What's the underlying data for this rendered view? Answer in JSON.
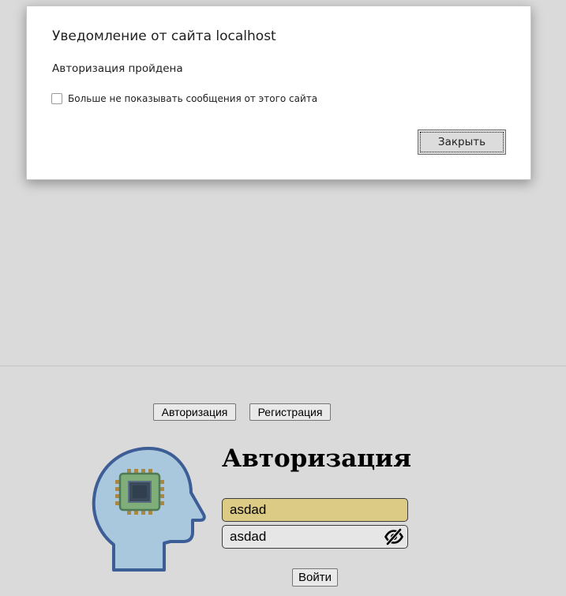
{
  "dialog": {
    "title": "Уведомление от сайта localhost",
    "message": "Авторизация пройдена",
    "suppress_checkbox": {
      "label": "Больше не показывать сообщения от этого сайта",
      "checked": false
    },
    "close_label": "Закрыть"
  },
  "nav": {
    "login_label": "Авторизация",
    "register_label": "Регистрация"
  },
  "form": {
    "title": "Авторизация",
    "login_value": "asdad",
    "password_value": "asdad",
    "submit_label": "Войти",
    "password_toggle_icon": "eye-slash-icon"
  },
  "illustration": {
    "icon": "head-with-chip-icon"
  },
  "colors": {
    "page_background": "#dadada",
    "dialog_background": "#ffffff",
    "login_field_background": "#dccb85",
    "password_field_background": "#e6e6e6",
    "head_fill": "#a9c7dd",
    "head_outline": "#3d5d96",
    "chip_body": "#7fae7a",
    "chip_pins": "#a98845",
    "chip_core": "#3a4a5a"
  }
}
